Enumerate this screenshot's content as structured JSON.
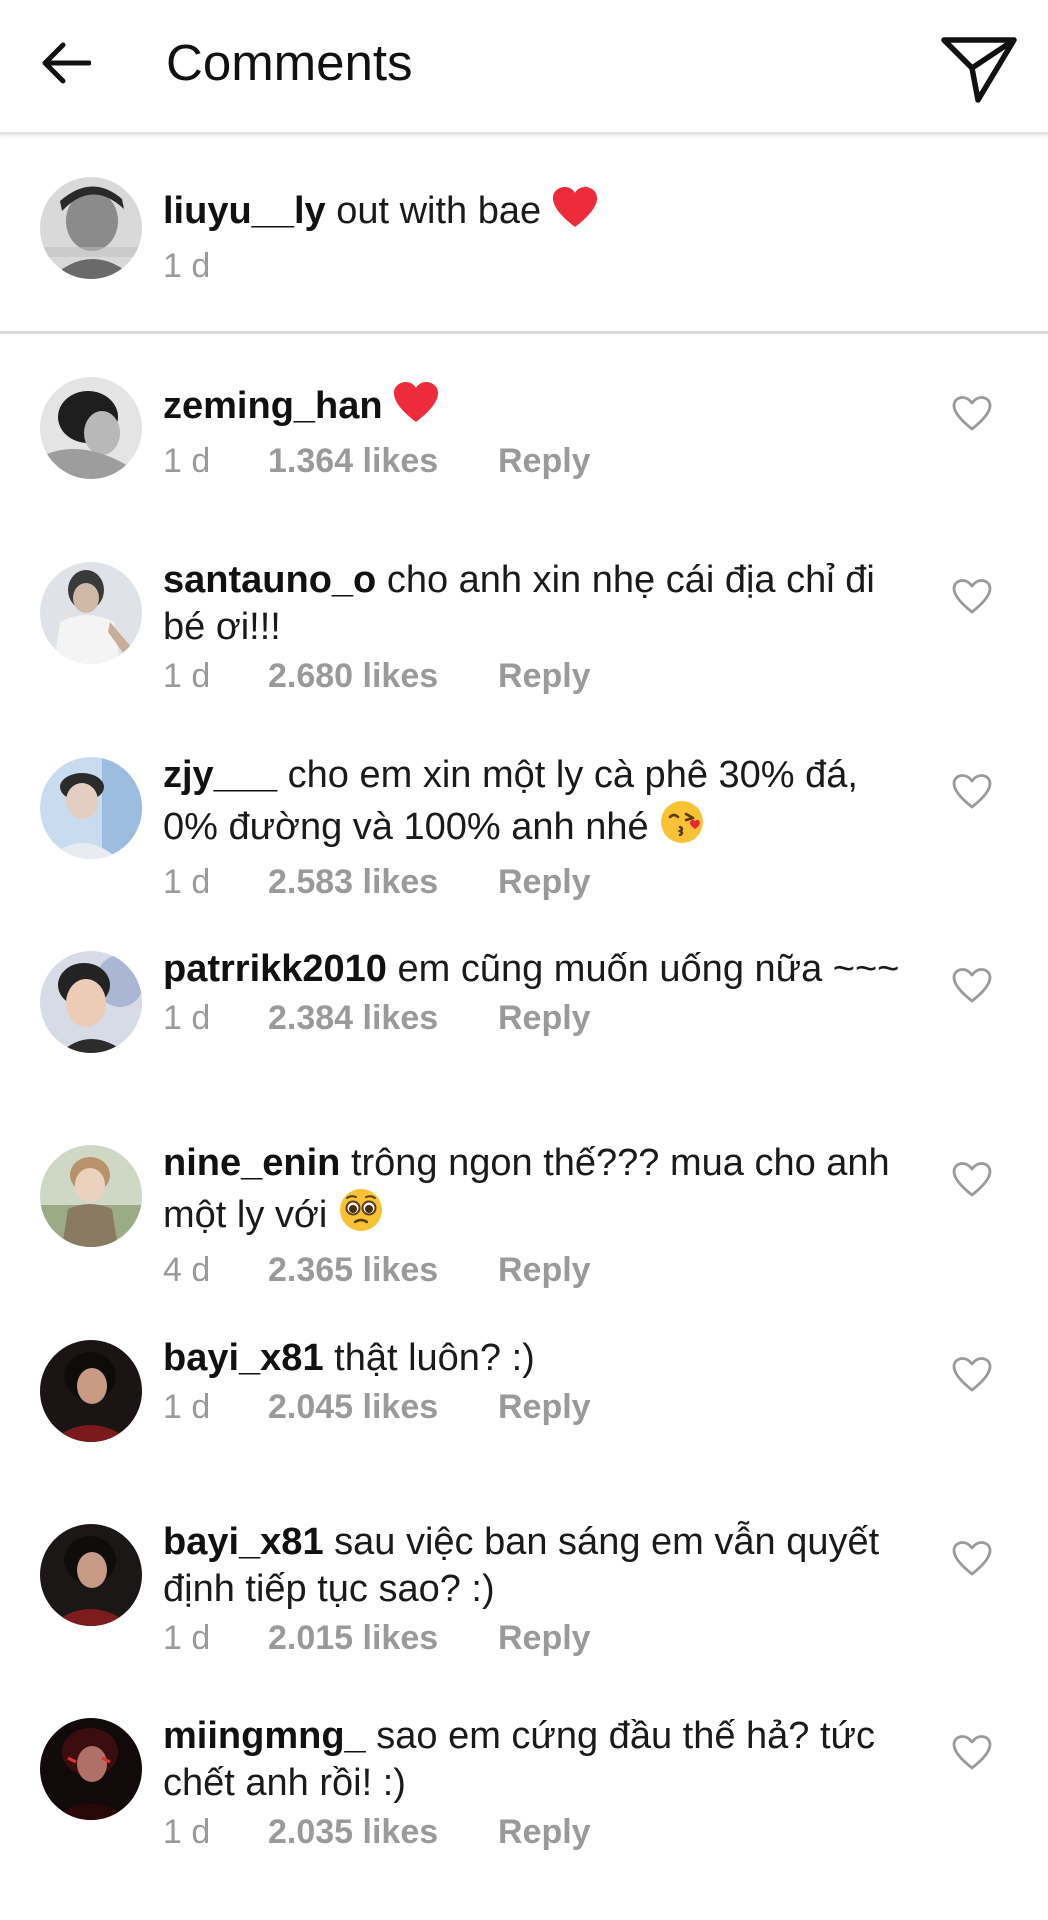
{
  "header": {
    "title": "Comments",
    "back_icon": "arrow-left-icon",
    "send_icon": "paper-plane-icon"
  },
  "caption": {
    "username": "liuyu__ly",
    "text": "out with bae",
    "emoji": "red-heart",
    "time": "1 d"
  },
  "comments": [
    {
      "username": "zeming_han",
      "text": "",
      "emoji": "red-heart",
      "time": "1 d",
      "likes": "1.364 likes",
      "reply": "Reply"
    },
    {
      "username": "santauno_o",
      "text": "cho anh xin nhẹ cái địa chỉ đi bé ơi!!!",
      "emoji": "",
      "time": "1 d",
      "likes": "2.680 likes",
      "reply": "Reply"
    },
    {
      "username": "zjy___",
      "text": "cho em xin một ly cà phê 30% đá, 0% đường và 100% anh nhé",
      "emoji": "kissing-face",
      "time": "1 d",
      "likes": "2.583 likes",
      "reply": "Reply"
    },
    {
      "username": "patrrikk2010",
      "text": "em cũng muốn uống nữa ~~~",
      "emoji": "",
      "time": "1 d",
      "likes": "2.384 likes",
      "reply": "Reply"
    },
    {
      "username": "nine_enin",
      "text": "trông ngon thế??? mua cho anh một ly với",
      "emoji": "pleading-face",
      "time": "4 d",
      "likes": "2.365 likes",
      "reply": "Reply"
    },
    {
      "username": "bayi_x81",
      "text": "thật luôn? :)",
      "emoji": "",
      "time": "1 d",
      "likes": "2.045 likes",
      "reply": "Reply"
    },
    {
      "username": "bayi_x81",
      "text": "sau việc ban sáng em vẫn quyết định tiếp tục sao? :)",
      "emoji": "",
      "time": "1 d",
      "likes": "2.015 likes",
      "reply": "Reply"
    },
    {
      "username": "miingmng_",
      "text": "sao em cứng đầu thế hả? tức chết anh rồi! :)",
      "emoji": "",
      "time": "1 d",
      "likes": "2.035 likes",
      "reply": "Reply"
    }
  ],
  "colors": {
    "meta_gray": "#9a9a9a",
    "heart_red": "#ed2b3b",
    "divider": "#dcdcdc"
  }
}
